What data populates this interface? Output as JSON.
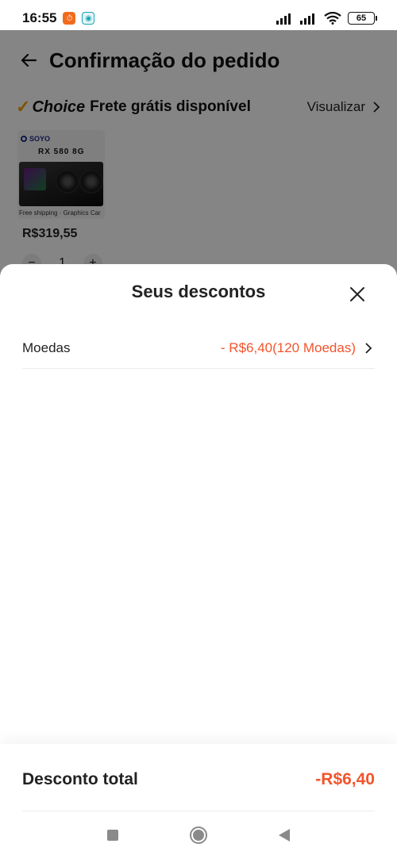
{
  "status_bar": {
    "time": "16:55",
    "battery": "65"
  },
  "header": {
    "title": "Confirmação do pedido"
  },
  "choice": {
    "logo": "Choice",
    "text": "Frete grátis disponível",
    "view_label": "Visualizar"
  },
  "product": {
    "brand": "SOYO",
    "model": "RX 580 8G",
    "caption": "Free shipping · Graphics Car",
    "price": "R$319,55",
    "quantity": "1"
  },
  "sheet": {
    "title": "Seus descontos",
    "coins": {
      "label": "Moedas",
      "value": "- R$6,40(120 Moedas)"
    },
    "total": {
      "label": "Desconto total",
      "value": "-R$6,40"
    }
  },
  "colors": {
    "accent": "#f2552c",
    "choice_check": "#f0a200"
  },
  "icons": [
    "back-arrow-icon",
    "chevron-right-icon",
    "close-icon",
    "wifi-icon",
    "signal-icon",
    "battery-icon"
  ]
}
